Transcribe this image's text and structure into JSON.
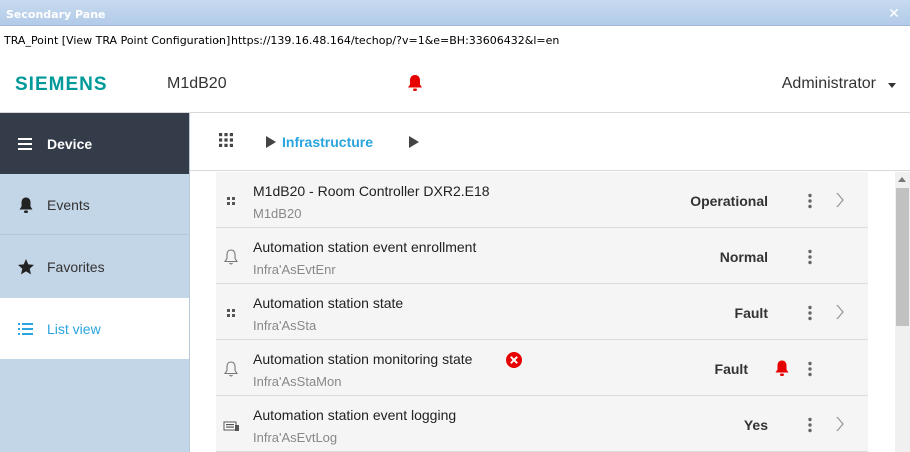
{
  "window": {
    "title": "Secondary Pane",
    "close_glyph": "✕"
  },
  "urlbar": {
    "caption": "TRA_Point [View TRA Point Configuration]",
    "separator": "-",
    "url": "https://139.16.48.164/techop/?v=1&e=BH:33606432&l=en"
  },
  "header": {
    "logo": "SIEMENS",
    "device": "M1dB20",
    "alarm_icon": "bell-icon",
    "user": "Administrator"
  },
  "sidebar": {
    "items": [
      {
        "label": "Device",
        "icon": "hamburger-icon",
        "active": false
      },
      {
        "label": "Events",
        "icon": "bell-icon",
        "active": false
      },
      {
        "label": "Favorites",
        "icon": "star-icon",
        "active": false
      },
      {
        "label": "List view",
        "icon": "list-icon",
        "active": true
      }
    ]
  },
  "breadcrumb": {
    "label": "Infrastructure"
  },
  "list": {
    "rows": [
      {
        "title": "M1dB20 - Room Controller DXR2.E18",
        "subtitle": "M1dB20",
        "status": "Operational",
        "icon": "grid-dots-icon",
        "has_chevron": true,
        "alarm": false,
        "error": false
      },
      {
        "title": "Automation station event enrollment",
        "subtitle": "Infra'AsEvtEnr",
        "status": "Normal",
        "icon": "bell-outline-icon",
        "has_chevron": false,
        "alarm": false,
        "error": false
      },
      {
        "title": "Automation station state",
        "subtitle": "Infra'AsSta",
        "status": "Fault",
        "icon": "grid-dots-icon",
        "has_chevron": true,
        "alarm": false,
        "error": false
      },
      {
        "title": "Automation station monitoring state",
        "subtitle": "Infra'AsStaMon",
        "status": "Fault",
        "icon": "bell-outline-icon",
        "has_chevron": false,
        "alarm": true,
        "error": true
      },
      {
        "title": "Automation station event logging",
        "subtitle": "Infra'AsEvtLog",
        "status": "Yes",
        "icon": "log-icon",
        "has_chevron": true,
        "alarm": false,
        "error": false
      }
    ]
  },
  "colors": {
    "brand": "#009999",
    "accent": "#2aa4de",
    "alarm": "#e60000",
    "sidebar_dark": "#333c48",
    "sidebar_bg": "#c3d6e7"
  }
}
